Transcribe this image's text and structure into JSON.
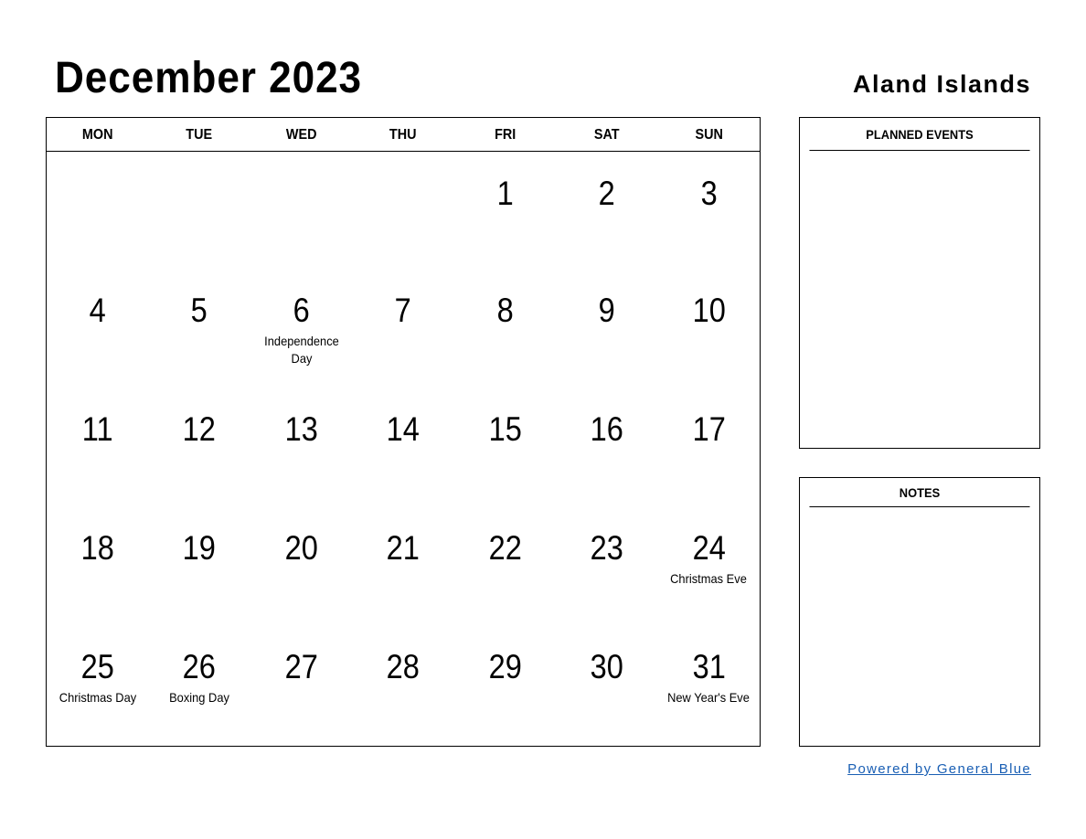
{
  "header": {
    "title": "December 2023",
    "region": "Aland Islands"
  },
  "calendar": {
    "weekdays": [
      "MON",
      "TUE",
      "WED",
      "THU",
      "FRI",
      "SAT",
      "SUN"
    ],
    "weeks": [
      [
        {
          "day": ""
        },
        {
          "day": ""
        },
        {
          "day": ""
        },
        {
          "day": ""
        },
        {
          "day": "1"
        },
        {
          "day": "2"
        },
        {
          "day": "3"
        }
      ],
      [
        {
          "day": "4"
        },
        {
          "day": "5"
        },
        {
          "day": "6",
          "holiday": "Independence Day"
        },
        {
          "day": "7"
        },
        {
          "day": "8"
        },
        {
          "day": "9"
        },
        {
          "day": "10"
        }
      ],
      [
        {
          "day": "11"
        },
        {
          "day": "12"
        },
        {
          "day": "13"
        },
        {
          "day": "14"
        },
        {
          "day": "15"
        },
        {
          "day": "16"
        },
        {
          "day": "17"
        }
      ],
      [
        {
          "day": "18"
        },
        {
          "day": "19"
        },
        {
          "day": "20"
        },
        {
          "day": "21"
        },
        {
          "day": "22"
        },
        {
          "day": "23"
        },
        {
          "day": "24",
          "holiday": "Christmas Eve"
        }
      ],
      [
        {
          "day": "25",
          "holiday": "Christmas Day"
        },
        {
          "day": "26",
          "holiday": "Boxing Day"
        },
        {
          "day": "27"
        },
        {
          "day": "28"
        },
        {
          "day": "29"
        },
        {
          "day": "30"
        },
        {
          "day": "31",
          "holiday": "New Year's Eve"
        }
      ]
    ]
  },
  "sidebar": {
    "planned_events_label": "PLANNED EVENTS",
    "notes_label": "NOTES"
  },
  "footer": {
    "powered_by": "Powered by General Blue",
    "link_color": "#1a5fb4"
  }
}
